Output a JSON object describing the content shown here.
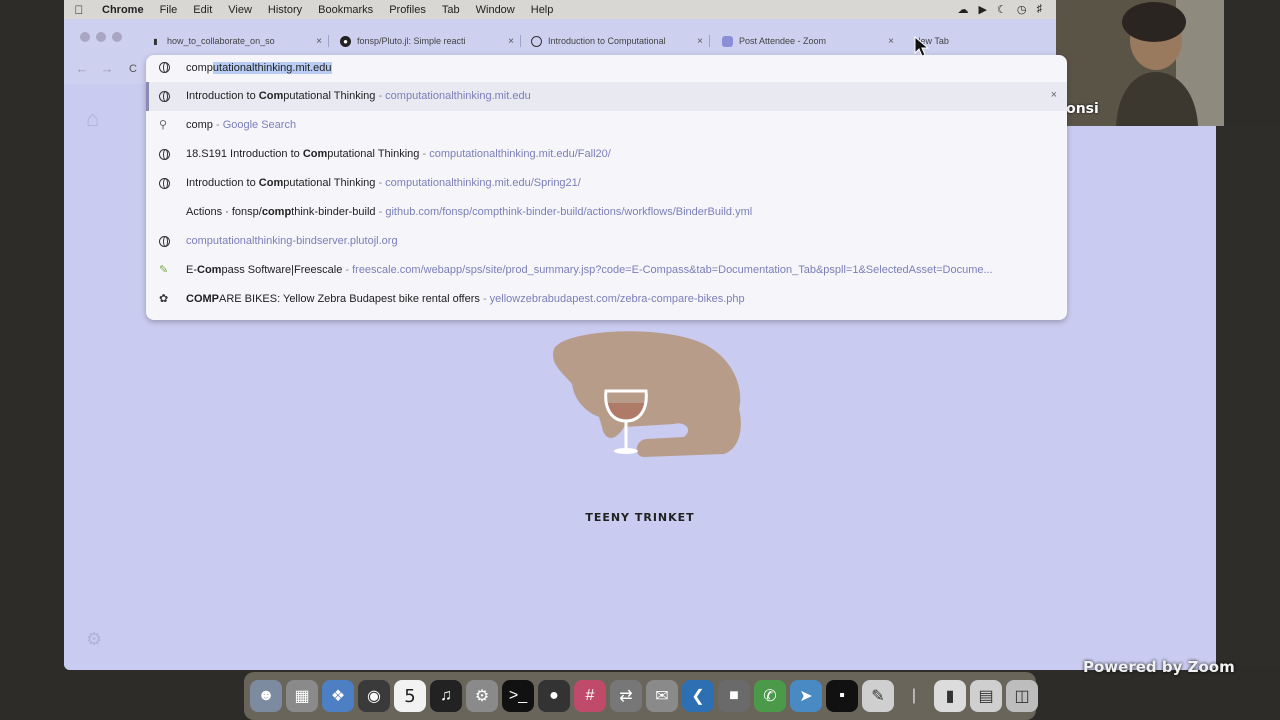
{
  "menubar": {
    "app_name": "Chrome",
    "items": [
      "File",
      "Edit",
      "View",
      "History",
      "Bookmarks",
      "Profiles",
      "Tab",
      "Window",
      "Help"
    ]
  },
  "tabs": [
    {
      "title": "how_to_collaborate_on_so",
      "icon": "pluto-icon",
      "close": "×"
    },
    {
      "title": "fonsp/Pluto.jl: Simple reacti",
      "icon": "github-icon",
      "close": "×"
    },
    {
      "title": "Introduction to Computational",
      "icon": "globe-icon",
      "close": "×"
    },
    {
      "title": "Post Attendee - Zoom",
      "icon": "zoom-icon",
      "close": "×"
    },
    {
      "title": "New Tab",
      "icon": "",
      "close": ""
    }
  ],
  "nav": {
    "back": "←",
    "forward": "→",
    "reload": "C"
  },
  "omnibox": {
    "typed": "comp",
    "completion": "utationalthinking.mit.edu",
    "suggestions": [
      {
        "icon": "globe-icon",
        "pre": "Introduction to ",
        "match": "Com",
        "post": "putational Thinking",
        "sep": " - ",
        "url": "computationalthinking.mit.edu",
        "remove": "×"
      },
      {
        "icon": "search-icon",
        "pre": "",
        "match": "",
        "post": "comp",
        "sep": " - ",
        "url": "Google Search",
        "remove": ""
      },
      {
        "icon": "globe-icon",
        "pre": "18.S191 Introduction to ",
        "match": "Com",
        "post": "putational Thinking",
        "sep": " - ",
        "url": "computationalthinking.mit.edu/Fall20/",
        "remove": ""
      },
      {
        "icon": "globe-icon",
        "pre": "Introduction to ",
        "match": "Com",
        "post": "putational Thinking",
        "sep": " - ",
        "url": "computationalthinking.mit.edu/Spring21/",
        "remove": ""
      },
      {
        "icon": "",
        "pre": "Actions · fonsp/",
        "match": "comp",
        "post": "think-binder-build",
        "sep": " - ",
        "url": "github.com/fonsp/compthink-binder-build/actions/workflows/BinderBuild.yml",
        "remove": ""
      },
      {
        "icon": "globe-icon",
        "pre": "",
        "match": "",
        "post": "computationalthinking-bindserver.plutojl.org",
        "sep": "",
        "url": "",
        "remove": ""
      },
      {
        "icon": "pen-icon",
        "pre": "E-",
        "match": "Com",
        "post": "pass Software|Freescale",
        "sep": " - ",
        "url": "freescale.com/webapp/sps/site/prod_summary.jsp?code=E-Compass&tab=Documentation_Tab&pspll=1&SelectedAsset=Docume...",
        "remove": ""
      },
      {
        "icon": "bike-icon",
        "pre": "",
        "match": "COMP",
        "post": "ARE BIKES: Yellow Zebra Budapest bike rental offers",
        "sep": " - ",
        "url": "yellowzebrabudapest.com/zebra-compare-bikes.php",
        "remove": ""
      }
    ]
  },
  "page": {
    "artwork_title": "TEENY TRINKET"
  },
  "webcam": {
    "name": "fonsi"
  },
  "zoom": {
    "credit": "Powered by Zoom"
  },
  "dock": {
    "calendar_day": "5"
  },
  "colors": {
    "page_bg": "#c9cbf0",
    "cat": "#b89c8a",
    "dropdown_bg": "#f5f5fa",
    "url_text": "#7b7fb8"
  }
}
